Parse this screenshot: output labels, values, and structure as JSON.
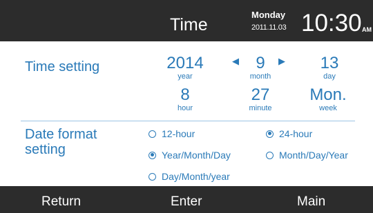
{
  "header": {
    "title": "Time",
    "weekday": "Monday",
    "date": "2011.11.03",
    "time": "10:30",
    "ampm": "AM"
  },
  "time_setting": {
    "label": "Time setting",
    "year": {
      "value": "2014",
      "unit": "year"
    },
    "month": {
      "value": "9",
      "unit": "month",
      "prev_icon": "triangle-left",
      "next_icon": "triangle-right"
    },
    "day": {
      "value": "13",
      "unit": "day"
    },
    "hour": {
      "value": "8",
      "unit": "hour"
    },
    "minute": {
      "value": "27",
      "unit": "minute"
    },
    "week": {
      "value": "Mon.",
      "unit": "week"
    }
  },
  "date_format": {
    "label_line1": "Date format",
    "label_line2": "setting",
    "options": [
      {
        "label": "12-hour",
        "checked": false
      },
      {
        "label": "24-hour",
        "checked": true
      },
      {
        "label": "Year/Month/Day",
        "checked": true
      },
      {
        "label": "Month/Day/Year",
        "checked": false
      },
      {
        "label": "Day/Month/year",
        "checked": false
      }
    ]
  },
  "footer": {
    "return_label": "Return",
    "enter_label": "Enter",
    "main_label": "Main"
  },
  "colors": {
    "accent": "#2a7ab8",
    "bar": "#2c2c2c",
    "divider": "#9cc4e4"
  }
}
